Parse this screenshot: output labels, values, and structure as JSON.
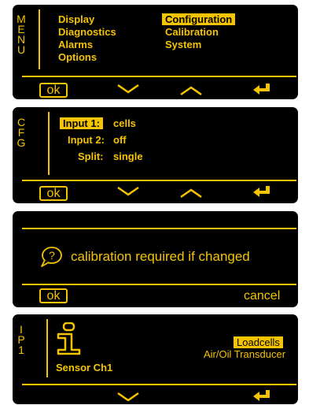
{
  "colors": {
    "accent": "#f5c400",
    "panel": "#000000",
    "background": "#ffffff"
  },
  "menu": {
    "side_letters": [
      "M",
      "E",
      "N",
      "U"
    ],
    "left_items": [
      "Display",
      "Diagnostics",
      "Alarms",
      "Options"
    ],
    "right_items": [
      "Configuration",
      "Calibration",
      "System"
    ],
    "selected": "Configuration",
    "buttons": {
      "ok": "ok",
      "down_icon": "chevron-down-icon",
      "up_icon": "chevron-up-icon",
      "enter_icon": "enter-icon"
    }
  },
  "cfg": {
    "side_letters": [
      "C",
      "F",
      "G"
    ],
    "rows": [
      {
        "label": "Input 1:",
        "value": "cells"
      },
      {
        "label": "Input 2:",
        "value": "off"
      },
      {
        "label": "Split:",
        "value": "single"
      }
    ],
    "selected_row": "Input 1:",
    "buttons": {
      "ok": "ok",
      "down_icon": "chevron-down-icon",
      "up_icon": "chevron-up-icon",
      "enter_icon": "enter-icon"
    }
  },
  "dialog": {
    "message": "calibration required if changed",
    "icon": "question-bubble-icon",
    "buttons": {
      "ok": "ok",
      "cancel": "cancel"
    }
  },
  "ip": {
    "side_letters": [
      "I",
      "P",
      "1"
    ],
    "icon": "info-icon",
    "sensor_label": "Sensor Ch1",
    "options": [
      "Loadcells",
      "Air/Oil Transducer"
    ],
    "selected": "Loadcells",
    "buttons": {
      "down_icon": "chevron-down-icon",
      "enter_icon": "enter-icon"
    }
  }
}
